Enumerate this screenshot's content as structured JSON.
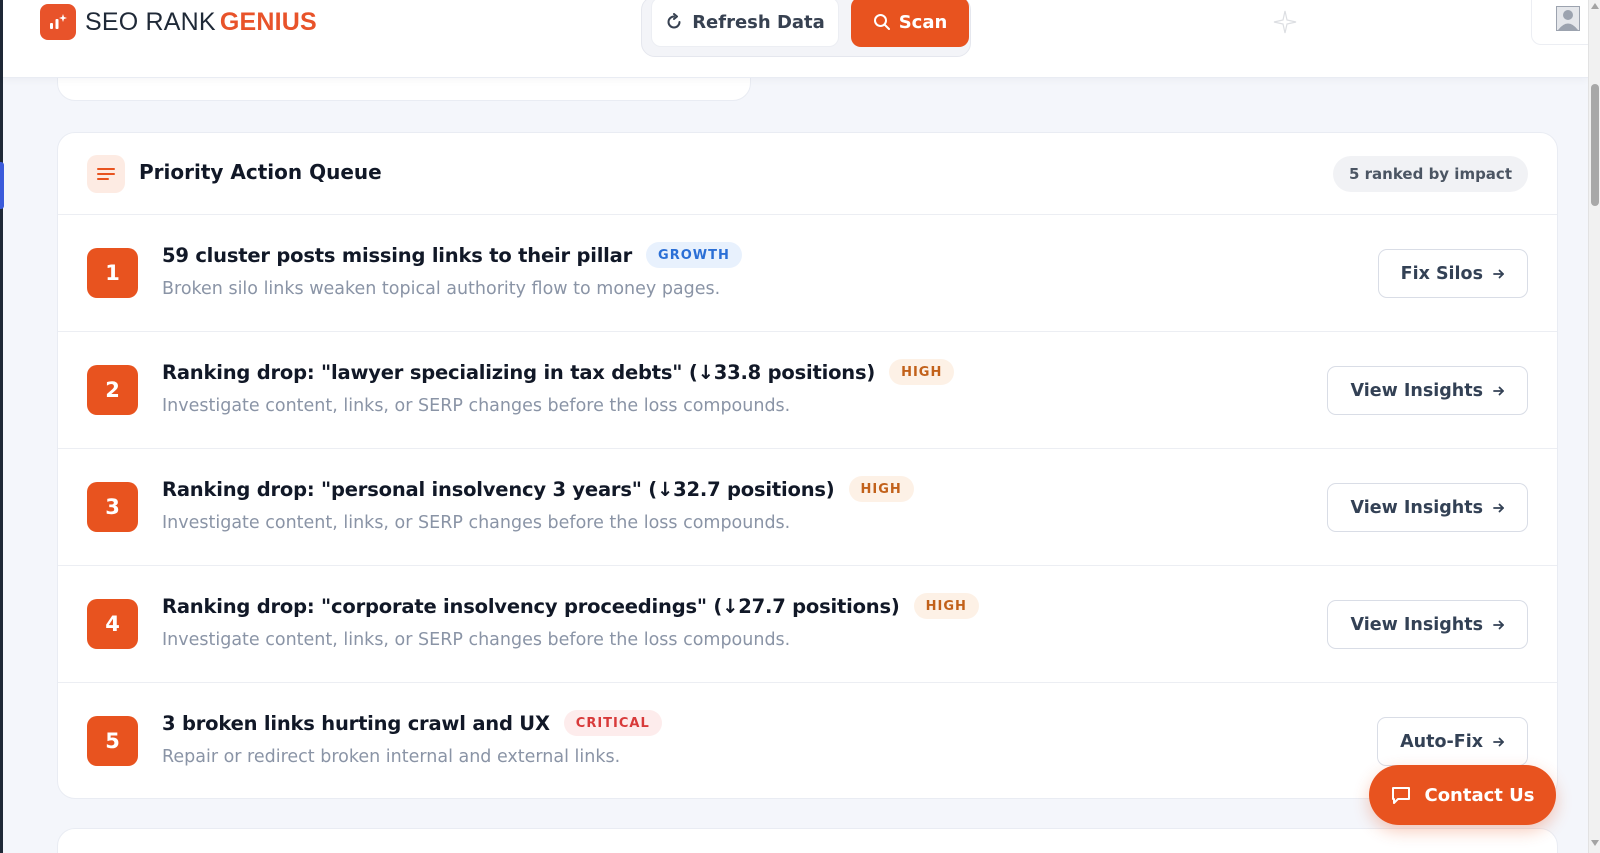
{
  "header": {
    "logo_text": "SEO RANK",
    "logo_accent": "GENIUS",
    "refresh_label": "Refresh Data",
    "scan_label": "Scan"
  },
  "queue": {
    "title": "Priority Action Queue",
    "badge": "5 ranked by impact",
    "items": [
      {
        "rank": "1",
        "title": "59 cluster posts missing links to their pillar",
        "tag": "GROWTH",
        "description": "Broken silo links weaken topical authority flow to money pages.",
        "action": "Fix Silos"
      },
      {
        "rank": "2",
        "title": "Ranking drop: \"lawyer specializing in tax debts\" (↓33.8 positions)",
        "tag": "HIGH",
        "description": "Investigate content, links, or SERP changes before the loss compounds.",
        "action": "View Insights"
      },
      {
        "rank": "3",
        "title": "Ranking drop: \"personal insolvency 3 years\" (↓32.7 positions)",
        "tag": "HIGH",
        "description": "Investigate content, links, or SERP changes before the loss compounds.",
        "action": "View Insights"
      },
      {
        "rank": "4",
        "title": "Ranking drop: \"corporate insolvency proceedings\" (↓27.7 positions)",
        "tag": "HIGH",
        "description": "Investigate content, links, or SERP changes before the loss compounds.",
        "action": "View Insights"
      },
      {
        "rank": "5",
        "title": "3 broken links hurting crawl and UX",
        "tag": "CRITICAL",
        "description": "Repair or redirect broken internal and external links.",
        "action": "Auto-Fix"
      }
    ]
  },
  "contact": {
    "label": "Contact Us"
  },
  "colors": {
    "brand": "#e8531f",
    "growth": "#2b6fd6",
    "high": "#c2611a",
    "critical": "#d83a3a"
  },
  "icons": {
    "logo": "chart-sparkle-icon",
    "refresh": "refresh-icon",
    "scan": "search-icon",
    "queue": "list-icon",
    "arrow": "arrow-right-icon",
    "contact": "chat-icon"
  }
}
